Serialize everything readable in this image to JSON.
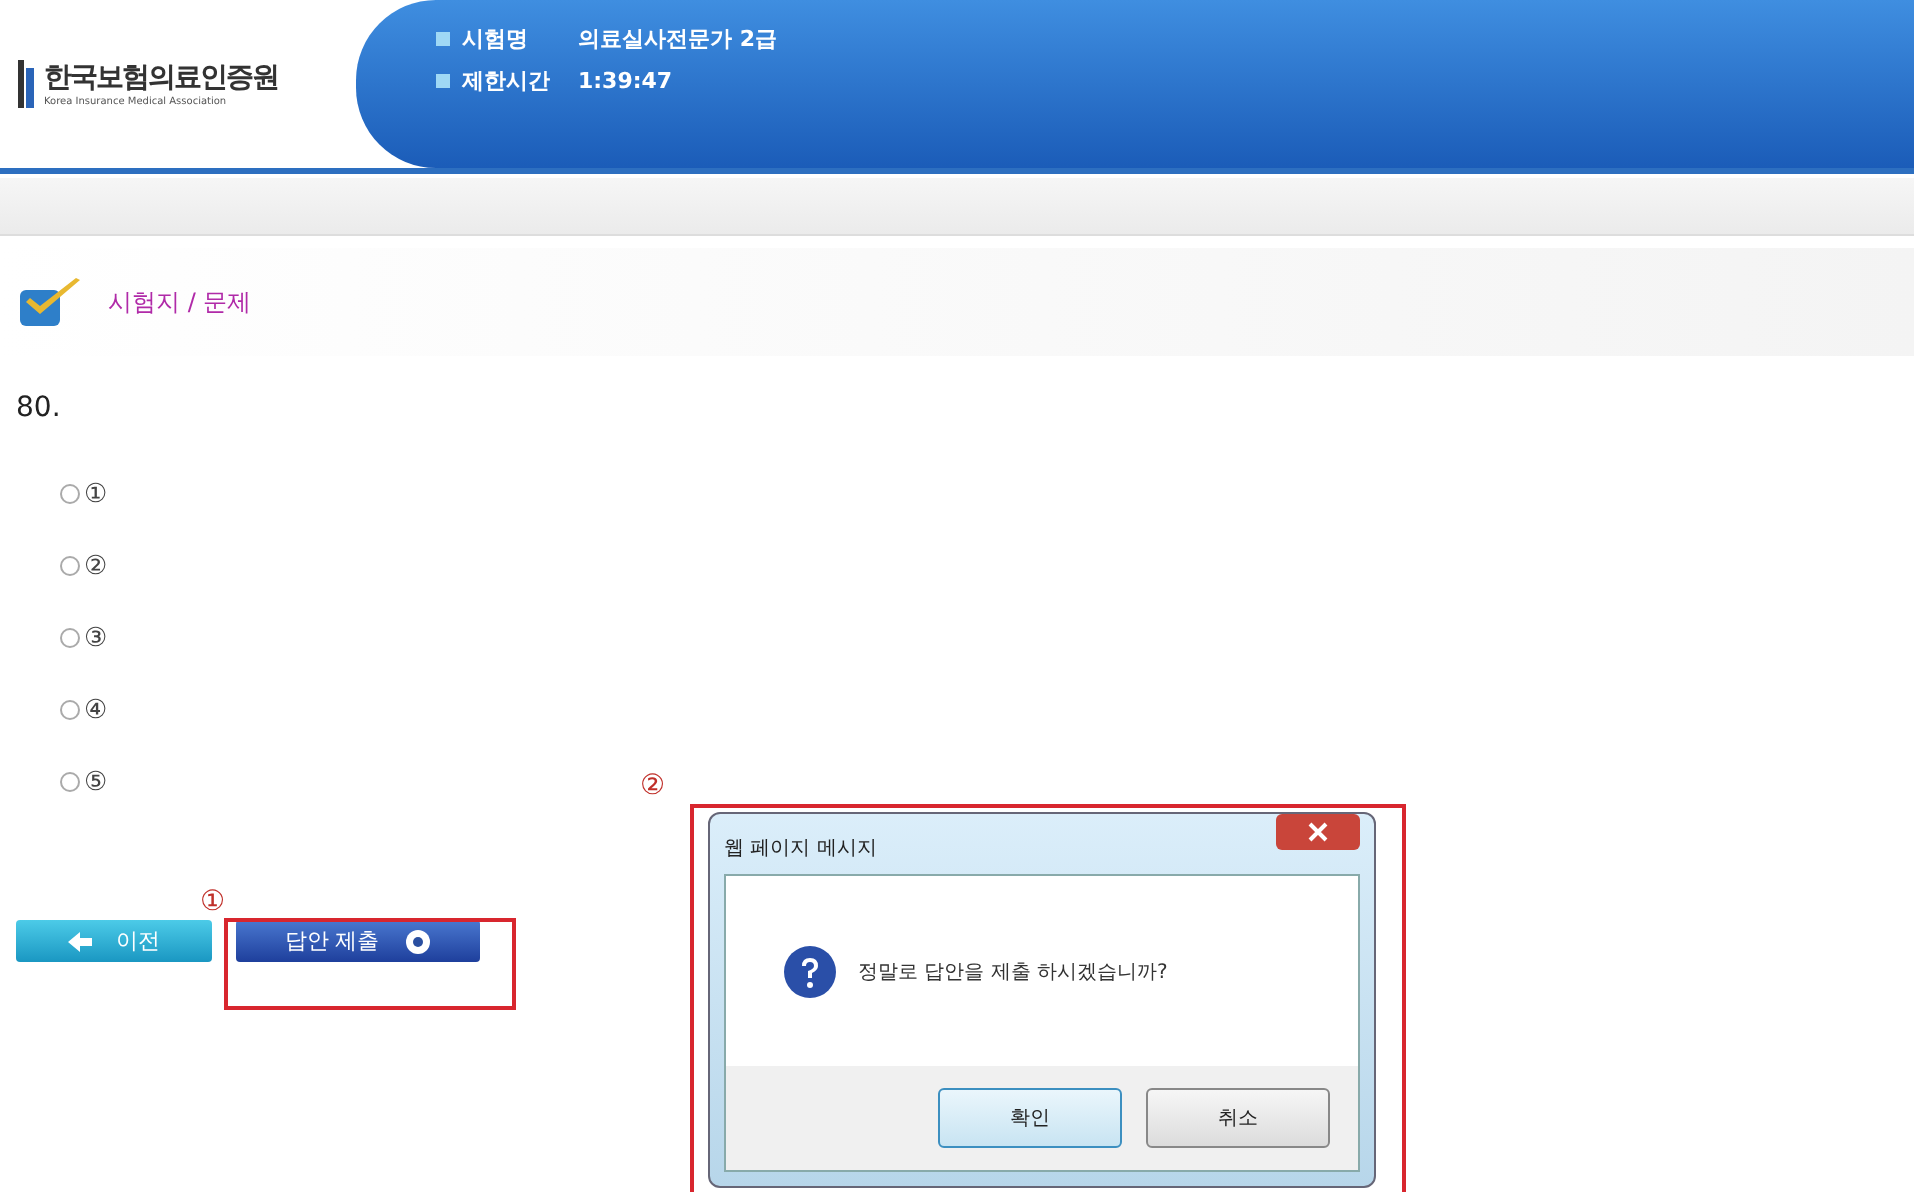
{
  "header": {
    "logo_title": "한국보험의료인증원",
    "logo_subtitle": "Korea Insurance Medical Association",
    "info": [
      {
        "label": "시험명",
        "value": "의료실사전문가 2급"
      },
      {
        "label": "제한시간",
        "value": "1:39:47"
      }
    ]
  },
  "section_title": "시험지 / 문제",
  "question": {
    "number": "80.",
    "options": [
      {
        "label": "①",
        "selected": false
      },
      {
        "label": "②",
        "selected": false
      },
      {
        "label": "③",
        "selected": false
      },
      {
        "label": "④",
        "selected": false
      },
      {
        "label": "⑤",
        "selected": false
      }
    ]
  },
  "buttons": [
    {
      "label": "이전",
      "kind": "prev"
    },
    {
      "label": "답안 제출",
      "kind": "submit"
    }
  ],
  "annotations": [
    {
      "label": "①"
    },
    {
      "label": "②"
    }
  ],
  "dialog": {
    "title": "웹 페이지 메시지",
    "message": "정말로 답안을 제출 하시겠습니까?",
    "buttons": [
      "확인",
      "취소"
    ]
  }
}
